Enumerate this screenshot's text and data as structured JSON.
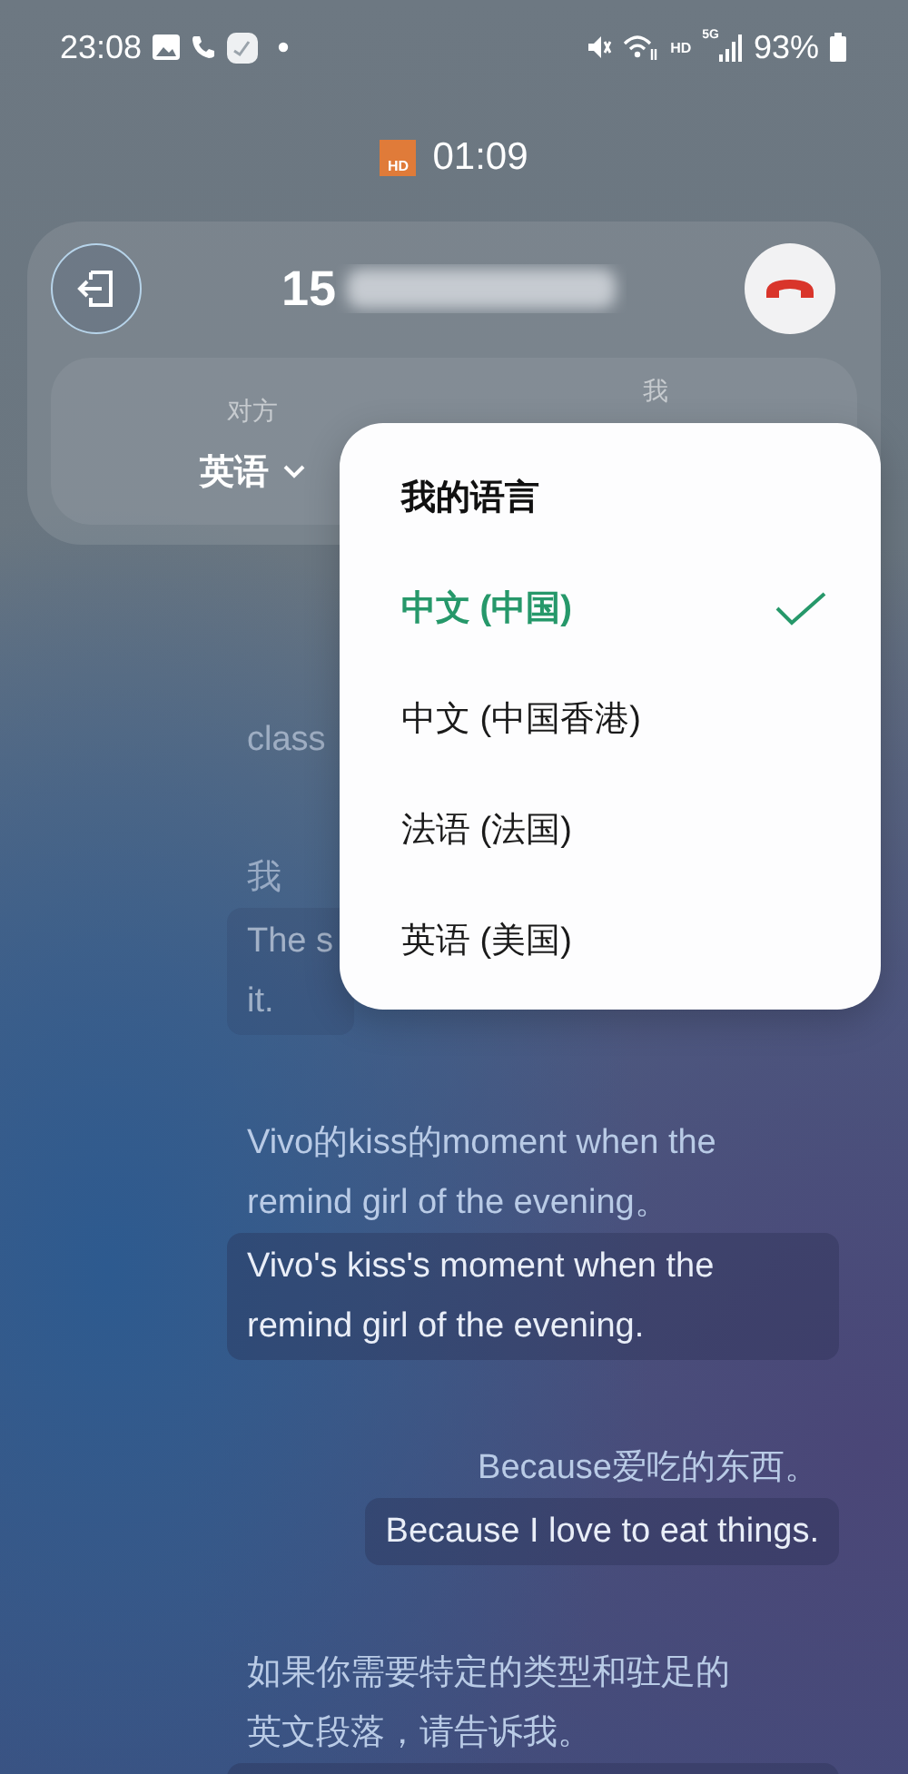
{
  "status_bar": {
    "time": "23:08",
    "hd": "HD",
    "network": "5G",
    "battery": "93%"
  },
  "call": {
    "timer": "01:09",
    "timer_badge": "HD",
    "number": "15"
  },
  "languages": {
    "them_label": "对方",
    "them_value": "英语",
    "me_label": "我"
  },
  "menu": {
    "title": "我的语言",
    "options": [
      {
        "label": "中文 (中国)",
        "selected": true
      },
      {
        "label": "中文 (中国香港)",
        "selected": false
      },
      {
        "label": "法语 (法国)",
        "selected": false
      },
      {
        "label": "英语 (美国)",
        "selected": false
      }
    ]
  },
  "transcript": [
    {
      "kind": "left",
      "faded": true,
      "source": "class"
    },
    {
      "kind": "left",
      "faded": true,
      "source": "我",
      "translation": "The s\nit."
    },
    {
      "kind": "left",
      "faded": false,
      "source": "Vivo的kiss的moment when the remind girl of the evening。",
      "translation": "Vivo's kiss's moment when the remind girl of the evening."
    },
    {
      "kind": "right",
      "faded": false,
      "source": "Because爱吃的东西。",
      "translation": "Because I love to eat things."
    },
    {
      "kind": "left",
      "faded": false,
      "source": "如果你需要特定的类型和驻足的英文段落，请告诉我。",
      "bubble_cut": true
    }
  ]
}
